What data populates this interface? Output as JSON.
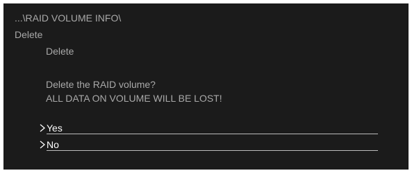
{
  "breadcrumb": "...\\RAID VOLUME INFO\\",
  "section_title": "Delete",
  "subsection_title": "Delete",
  "prompt": {
    "question": "Delete the RAID volume?",
    "warning": "ALL DATA ON VOLUME WILL BE LOST!"
  },
  "options": [
    {
      "label": "Yes",
      "icon": "chevron-right-icon"
    },
    {
      "label": "No",
      "icon": "chevron-right-icon"
    }
  ],
  "colors": {
    "background": "#1b1b1b",
    "text": "#a9a9a9",
    "option_text": "#ffffff"
  }
}
